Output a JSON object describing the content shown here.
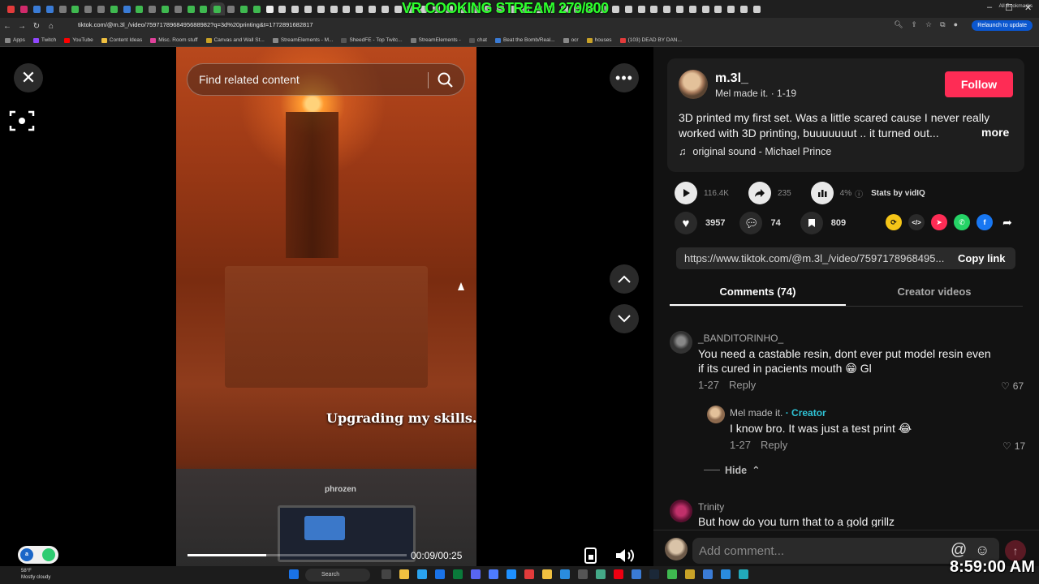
{
  "overlay": {
    "stream_title": "VR COOKING STREAM 279/800",
    "clock": "8:59:00 AM"
  },
  "browser": {
    "url": "tiktok.com/@m.3l_/video/7597178968495688982?q=3d%20printing&t=1772891682817",
    "relaunch_label": "Relaunch to update",
    "bookmarks": [
      "Apps",
      "Twitch",
      "YouTube",
      "Content Ideas",
      "Misc. Room stuff",
      "Canvas and Wall St...",
      "StreamElements - M...",
      "SheedFE - Top Twitc...",
      "StreamElements -",
      "chat",
      "Beat the Bomb/Real...",
      "ocr",
      "houses",
      "(103) DEAD BY DAN..."
    ],
    "all_bookmarks": "All Bookmarks",
    "tab_colors": [
      "#e23b3b",
      "#d02a6b",
      "#3a7bd5",
      "#3a7bd5",
      "#7a7a7a",
      "#3fb950",
      "#7a7a7a",
      "#7a7a7a",
      "#3fb950",
      "#3a7bd5",
      "#3fb950",
      "#7a7a7a",
      "#3fb950",
      "#7a7a7a",
      "#3fb950",
      "#3fb950",
      "#3fb950",
      "#7a7a7a",
      "#3fb950",
      "#3fb950",
      "#eee"
    ]
  },
  "video": {
    "search_placeholder": "Find related content",
    "caption": "Upgrading my skills.",
    "device_logo": "phrozen",
    "time": "00:09/00:25",
    "progress_fraction": 0.36
  },
  "post": {
    "username": "m.3l_",
    "nickname_date": "Mel made it. · 1-19",
    "follow_label": "Follow",
    "description": "3D printed my first set. Was a little scared cause I never really worked with 3D printing, buuuuuuut .. it turned out...",
    "more_label": "more",
    "sound": "original sound - Michael Prince",
    "stats": {
      "plays": "116.4K",
      "shares_stat": "235",
      "percent": "4%",
      "vidiq_label": "Stats by vidIQ"
    },
    "likes": "3957",
    "comments_count": "74",
    "saves": "809",
    "link": "https://www.tiktok.com/@m.3l_/video/7597178968495...",
    "copy_label": "Copy link"
  },
  "tabs": {
    "comments": "Comments (74)",
    "creator": "Creator videos"
  },
  "comments": [
    {
      "user": "_BANDITORINHO_",
      "text": "You need a castable resin, dont ever put model resin even if its cured in pacients mouth 😁 Gl",
      "date": "1-27",
      "reply": "Reply",
      "likes": "67"
    },
    {
      "user": "Mel made it.",
      "badge": "· Creator",
      "text": "I know bro. It was just a test print 😂",
      "date": "1-27",
      "reply": "Reply",
      "likes": "17"
    },
    {
      "user": "Trinity",
      "text": "But how do you turn that to a gold grillz"
    }
  ],
  "hide_label": "Hide",
  "add_comment_placeholder": "Add comment...",
  "taskbar": {
    "weather_temp": "58°F",
    "weather_desc": "Mostly cloudy",
    "search_label": "Search"
  }
}
